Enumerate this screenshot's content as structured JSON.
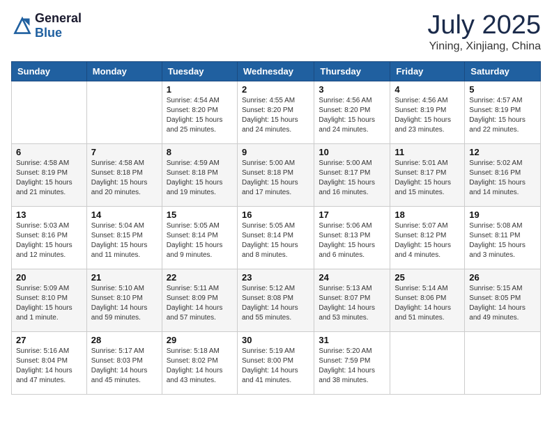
{
  "logo": {
    "general": "General",
    "blue": "Blue"
  },
  "title": {
    "month_year": "July 2025",
    "location": "Yining, Xinjiang, China"
  },
  "weekdays": [
    "Sunday",
    "Monday",
    "Tuesday",
    "Wednesday",
    "Thursday",
    "Friday",
    "Saturday"
  ],
  "weeks": [
    [
      {
        "day": "",
        "info": ""
      },
      {
        "day": "",
        "info": ""
      },
      {
        "day": "1",
        "info": "Sunrise: 4:54 AM\nSunset: 8:20 PM\nDaylight: 15 hours and 25 minutes."
      },
      {
        "day": "2",
        "info": "Sunrise: 4:55 AM\nSunset: 8:20 PM\nDaylight: 15 hours and 24 minutes."
      },
      {
        "day": "3",
        "info": "Sunrise: 4:56 AM\nSunset: 8:20 PM\nDaylight: 15 hours and 24 minutes."
      },
      {
        "day": "4",
        "info": "Sunrise: 4:56 AM\nSunset: 8:19 PM\nDaylight: 15 hours and 23 minutes."
      },
      {
        "day": "5",
        "info": "Sunrise: 4:57 AM\nSunset: 8:19 PM\nDaylight: 15 hours and 22 minutes."
      }
    ],
    [
      {
        "day": "6",
        "info": "Sunrise: 4:58 AM\nSunset: 8:19 PM\nDaylight: 15 hours and 21 minutes."
      },
      {
        "day": "7",
        "info": "Sunrise: 4:58 AM\nSunset: 8:18 PM\nDaylight: 15 hours and 20 minutes."
      },
      {
        "day": "8",
        "info": "Sunrise: 4:59 AM\nSunset: 8:18 PM\nDaylight: 15 hours and 19 minutes."
      },
      {
        "day": "9",
        "info": "Sunrise: 5:00 AM\nSunset: 8:18 PM\nDaylight: 15 hours and 17 minutes."
      },
      {
        "day": "10",
        "info": "Sunrise: 5:00 AM\nSunset: 8:17 PM\nDaylight: 15 hours and 16 minutes."
      },
      {
        "day": "11",
        "info": "Sunrise: 5:01 AM\nSunset: 8:17 PM\nDaylight: 15 hours and 15 minutes."
      },
      {
        "day": "12",
        "info": "Sunrise: 5:02 AM\nSunset: 8:16 PM\nDaylight: 15 hours and 14 minutes."
      }
    ],
    [
      {
        "day": "13",
        "info": "Sunrise: 5:03 AM\nSunset: 8:16 PM\nDaylight: 15 hours and 12 minutes."
      },
      {
        "day": "14",
        "info": "Sunrise: 5:04 AM\nSunset: 8:15 PM\nDaylight: 15 hours and 11 minutes."
      },
      {
        "day": "15",
        "info": "Sunrise: 5:05 AM\nSunset: 8:14 PM\nDaylight: 15 hours and 9 minutes."
      },
      {
        "day": "16",
        "info": "Sunrise: 5:05 AM\nSunset: 8:14 PM\nDaylight: 15 hours and 8 minutes."
      },
      {
        "day": "17",
        "info": "Sunrise: 5:06 AM\nSunset: 8:13 PM\nDaylight: 15 hours and 6 minutes."
      },
      {
        "day": "18",
        "info": "Sunrise: 5:07 AM\nSunset: 8:12 PM\nDaylight: 15 hours and 4 minutes."
      },
      {
        "day": "19",
        "info": "Sunrise: 5:08 AM\nSunset: 8:11 PM\nDaylight: 15 hours and 3 minutes."
      }
    ],
    [
      {
        "day": "20",
        "info": "Sunrise: 5:09 AM\nSunset: 8:10 PM\nDaylight: 15 hours and 1 minute."
      },
      {
        "day": "21",
        "info": "Sunrise: 5:10 AM\nSunset: 8:10 PM\nDaylight: 14 hours and 59 minutes."
      },
      {
        "day": "22",
        "info": "Sunrise: 5:11 AM\nSunset: 8:09 PM\nDaylight: 14 hours and 57 minutes."
      },
      {
        "day": "23",
        "info": "Sunrise: 5:12 AM\nSunset: 8:08 PM\nDaylight: 14 hours and 55 minutes."
      },
      {
        "day": "24",
        "info": "Sunrise: 5:13 AM\nSunset: 8:07 PM\nDaylight: 14 hours and 53 minutes."
      },
      {
        "day": "25",
        "info": "Sunrise: 5:14 AM\nSunset: 8:06 PM\nDaylight: 14 hours and 51 minutes."
      },
      {
        "day": "26",
        "info": "Sunrise: 5:15 AM\nSunset: 8:05 PM\nDaylight: 14 hours and 49 minutes."
      }
    ],
    [
      {
        "day": "27",
        "info": "Sunrise: 5:16 AM\nSunset: 8:04 PM\nDaylight: 14 hours and 47 minutes."
      },
      {
        "day": "28",
        "info": "Sunrise: 5:17 AM\nSunset: 8:03 PM\nDaylight: 14 hours and 45 minutes."
      },
      {
        "day": "29",
        "info": "Sunrise: 5:18 AM\nSunset: 8:02 PM\nDaylight: 14 hours and 43 minutes."
      },
      {
        "day": "30",
        "info": "Sunrise: 5:19 AM\nSunset: 8:00 PM\nDaylight: 14 hours and 41 minutes."
      },
      {
        "day": "31",
        "info": "Sunrise: 5:20 AM\nSunset: 7:59 PM\nDaylight: 14 hours and 38 minutes."
      },
      {
        "day": "",
        "info": ""
      },
      {
        "day": "",
        "info": ""
      }
    ]
  ]
}
